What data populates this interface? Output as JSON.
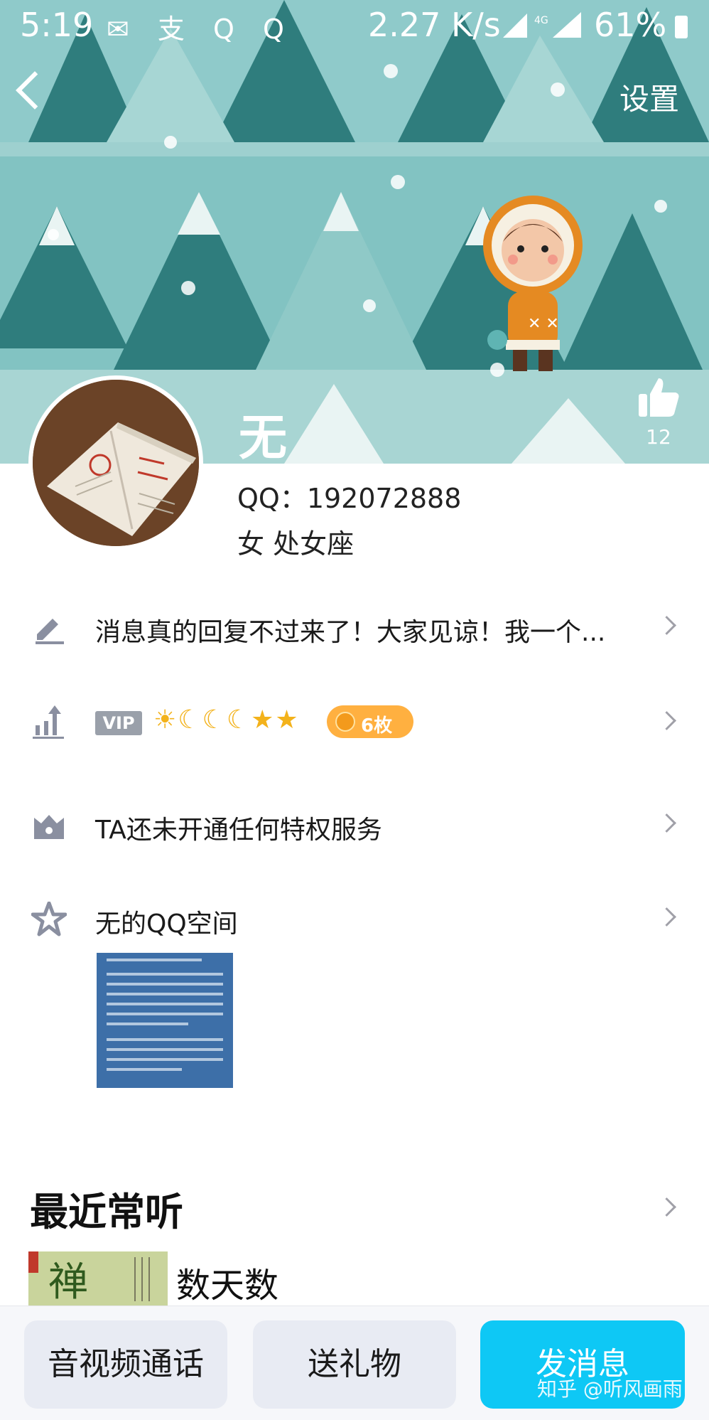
{
  "status_bar": {
    "time": "5:19",
    "app_icons": [
      "wechat-icon",
      "alipay-icon",
      "qq-icon",
      "qq-icon"
    ],
    "app_icon_glyphs": "✉ 支 Q Q",
    "network_speed": "2.27 K/s",
    "network": "4G",
    "battery": "61%"
  },
  "header": {
    "back_icon": "chevron-left-icon",
    "settings_label": "设置"
  },
  "profile": {
    "name": "无",
    "qq_label": "QQ：192072888",
    "gender_sign": "女  处女座",
    "likes": "12",
    "like_icon": "thumb-up-icon"
  },
  "rows": {
    "signature": {
      "icon": "edit-icon",
      "text": "消息真的回复不过来了！大家见谅！我一个..."
    },
    "level": {
      "icon": "level-up-icon",
      "vip": "VIP",
      "level_icons": [
        "sun",
        "moon",
        "moon",
        "moon",
        "star",
        "star"
      ],
      "level_glyphs": "☀☾☾☾★★",
      "medal": "6枚"
    },
    "privilege": {
      "icon": "crown-icon",
      "text": "TA还未开通任何特权服务"
    },
    "qzone": {
      "icon": "qzone-star-icon",
      "text": "无的QQ空间"
    }
  },
  "recent": {
    "title": "最近常听",
    "item": "数天数"
  },
  "bottom_bar": {
    "call": "音视频通话",
    "gift": "送礼物",
    "message": "发消息"
  },
  "watermark": "知乎 @听风画雨",
  "colors": {
    "banner_teal": "#7fbfbf",
    "primary_blue": "#0ec8f5",
    "medal_orange": "#ffb040",
    "icon_gray": "#8a8fa0"
  }
}
